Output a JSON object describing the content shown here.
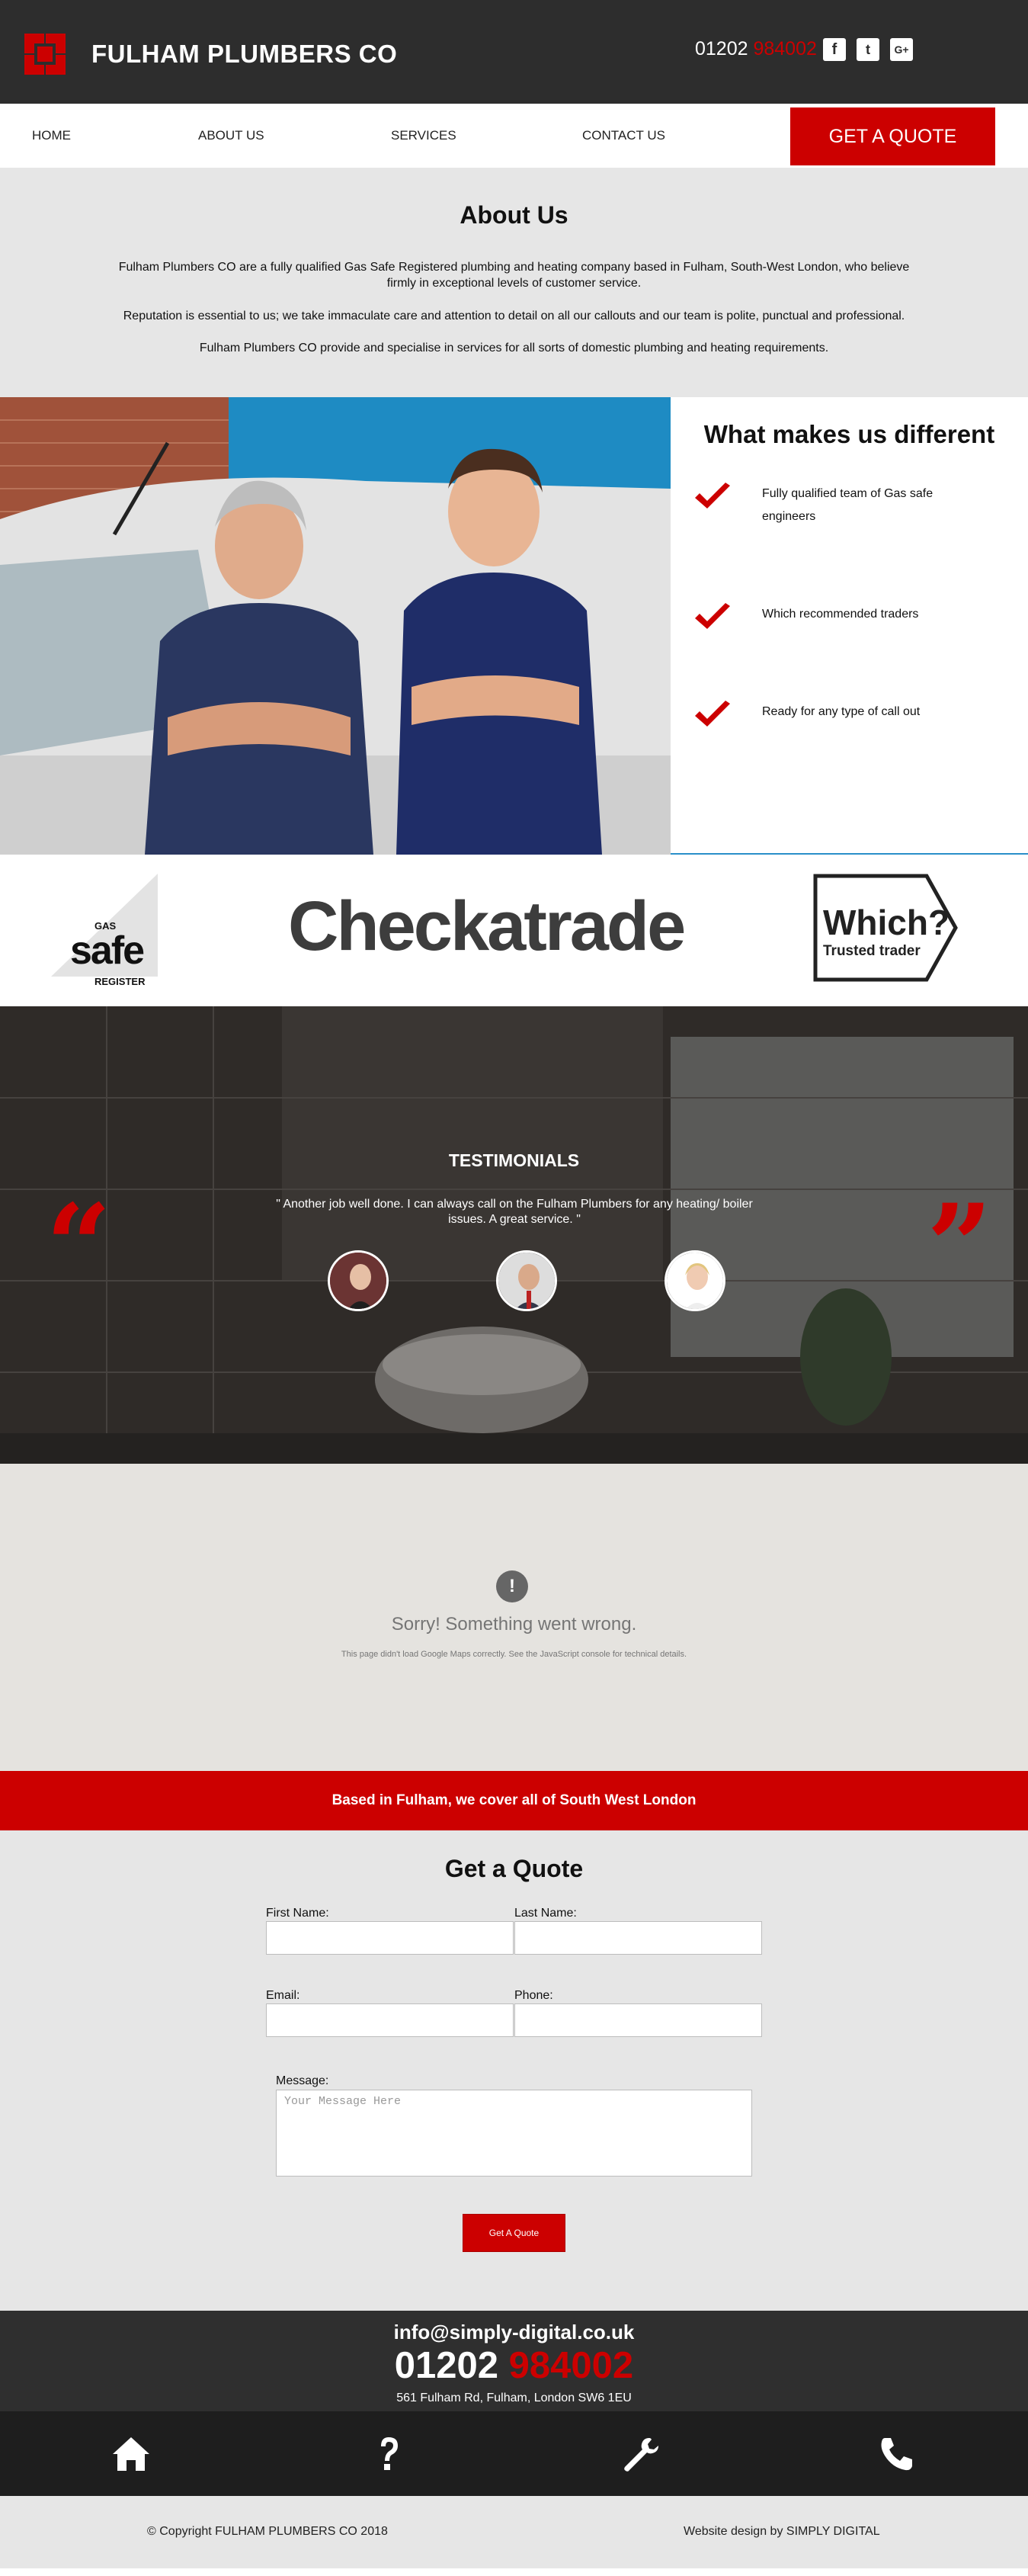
{
  "header": {
    "brand": "FULHAM PLUMBERS CO",
    "phone_prefix": "01202 ",
    "phone_suffix": "984002",
    "social": [
      {
        "icon": "facebook-icon",
        "glyph": "f"
      },
      {
        "icon": "twitter-icon",
        "glyph": "t"
      },
      {
        "icon": "google-plus-icon",
        "glyph": "G+"
      }
    ]
  },
  "nav": {
    "home": "HOME",
    "about": "ABOUT US",
    "services": "SERVICES",
    "contact": "CONTACT US",
    "quote": "GET A QUOTE"
  },
  "about": {
    "title": "About Us",
    "p1": "Fulham Plumbers CO are a fully qualified Gas Safe Registered plumbing and heating company based in Fulham, South-West London, who believe firmly in exceptional levels of customer service.",
    "p2": "Reputation is essential to us; we take immaculate care and attention to detail on all our callouts and our team is polite, punctual and professional.",
    "p3": "Fulham Plumbers CO provide and specialise in services for all sorts of domestic plumbing and heating requirements."
  },
  "different": {
    "title": "What makes us different",
    "items": [
      "Fully qualified team of Gas safe engineers",
      "Which recommended traders",
      "Ready for any type of call out"
    ]
  },
  "accreditations": {
    "gas_safe_small": "GAS",
    "gas_safe_big": "safe",
    "gas_safe_register": "REGISTER",
    "checkatrade": "Checkatrade",
    "which_big": "Which?",
    "which_small": "Trusted trader"
  },
  "testimonials": {
    "title": "TESTIMONIALS",
    "quote": "\" Another job well done. I can always call on the Fulham Plumbers for any heating/ boiler issues. A great service. \"",
    "open_mark": "“",
    "close_mark": "”"
  },
  "map": {
    "icon_glyph": "!",
    "title": "Sorry! Something went wrong.",
    "message": "This page didn't load Google Maps correctly. See the JavaScript console for technical details."
  },
  "coverage": {
    "text": "Based in Fulham, we cover all of South West London"
  },
  "quote_form": {
    "title": "Get a Quote",
    "first_name_label": "First Name:",
    "last_name_label": "Last Name:",
    "email_label": "Email:",
    "phone_label": "Phone:",
    "message_label": "Message:",
    "message_placeholder": "Your Message Here",
    "submit": "Get A Quote"
  },
  "contact": {
    "email": "info@simply-digital.co.uk",
    "phone_prefix": "01202 ",
    "phone_suffix": "984002",
    "address": "561 Fulham Rd, Fulham, London SW6 1EU"
  },
  "footer": {
    "copyright": "© Copyright FULHAM PLUMBERS CO 2018",
    "design": "Website design by SIMPLY DIGITAL"
  },
  "colors": {
    "accent": "#cc0000",
    "dark": "#2d2d2d",
    "light": "#e6e6e6"
  }
}
